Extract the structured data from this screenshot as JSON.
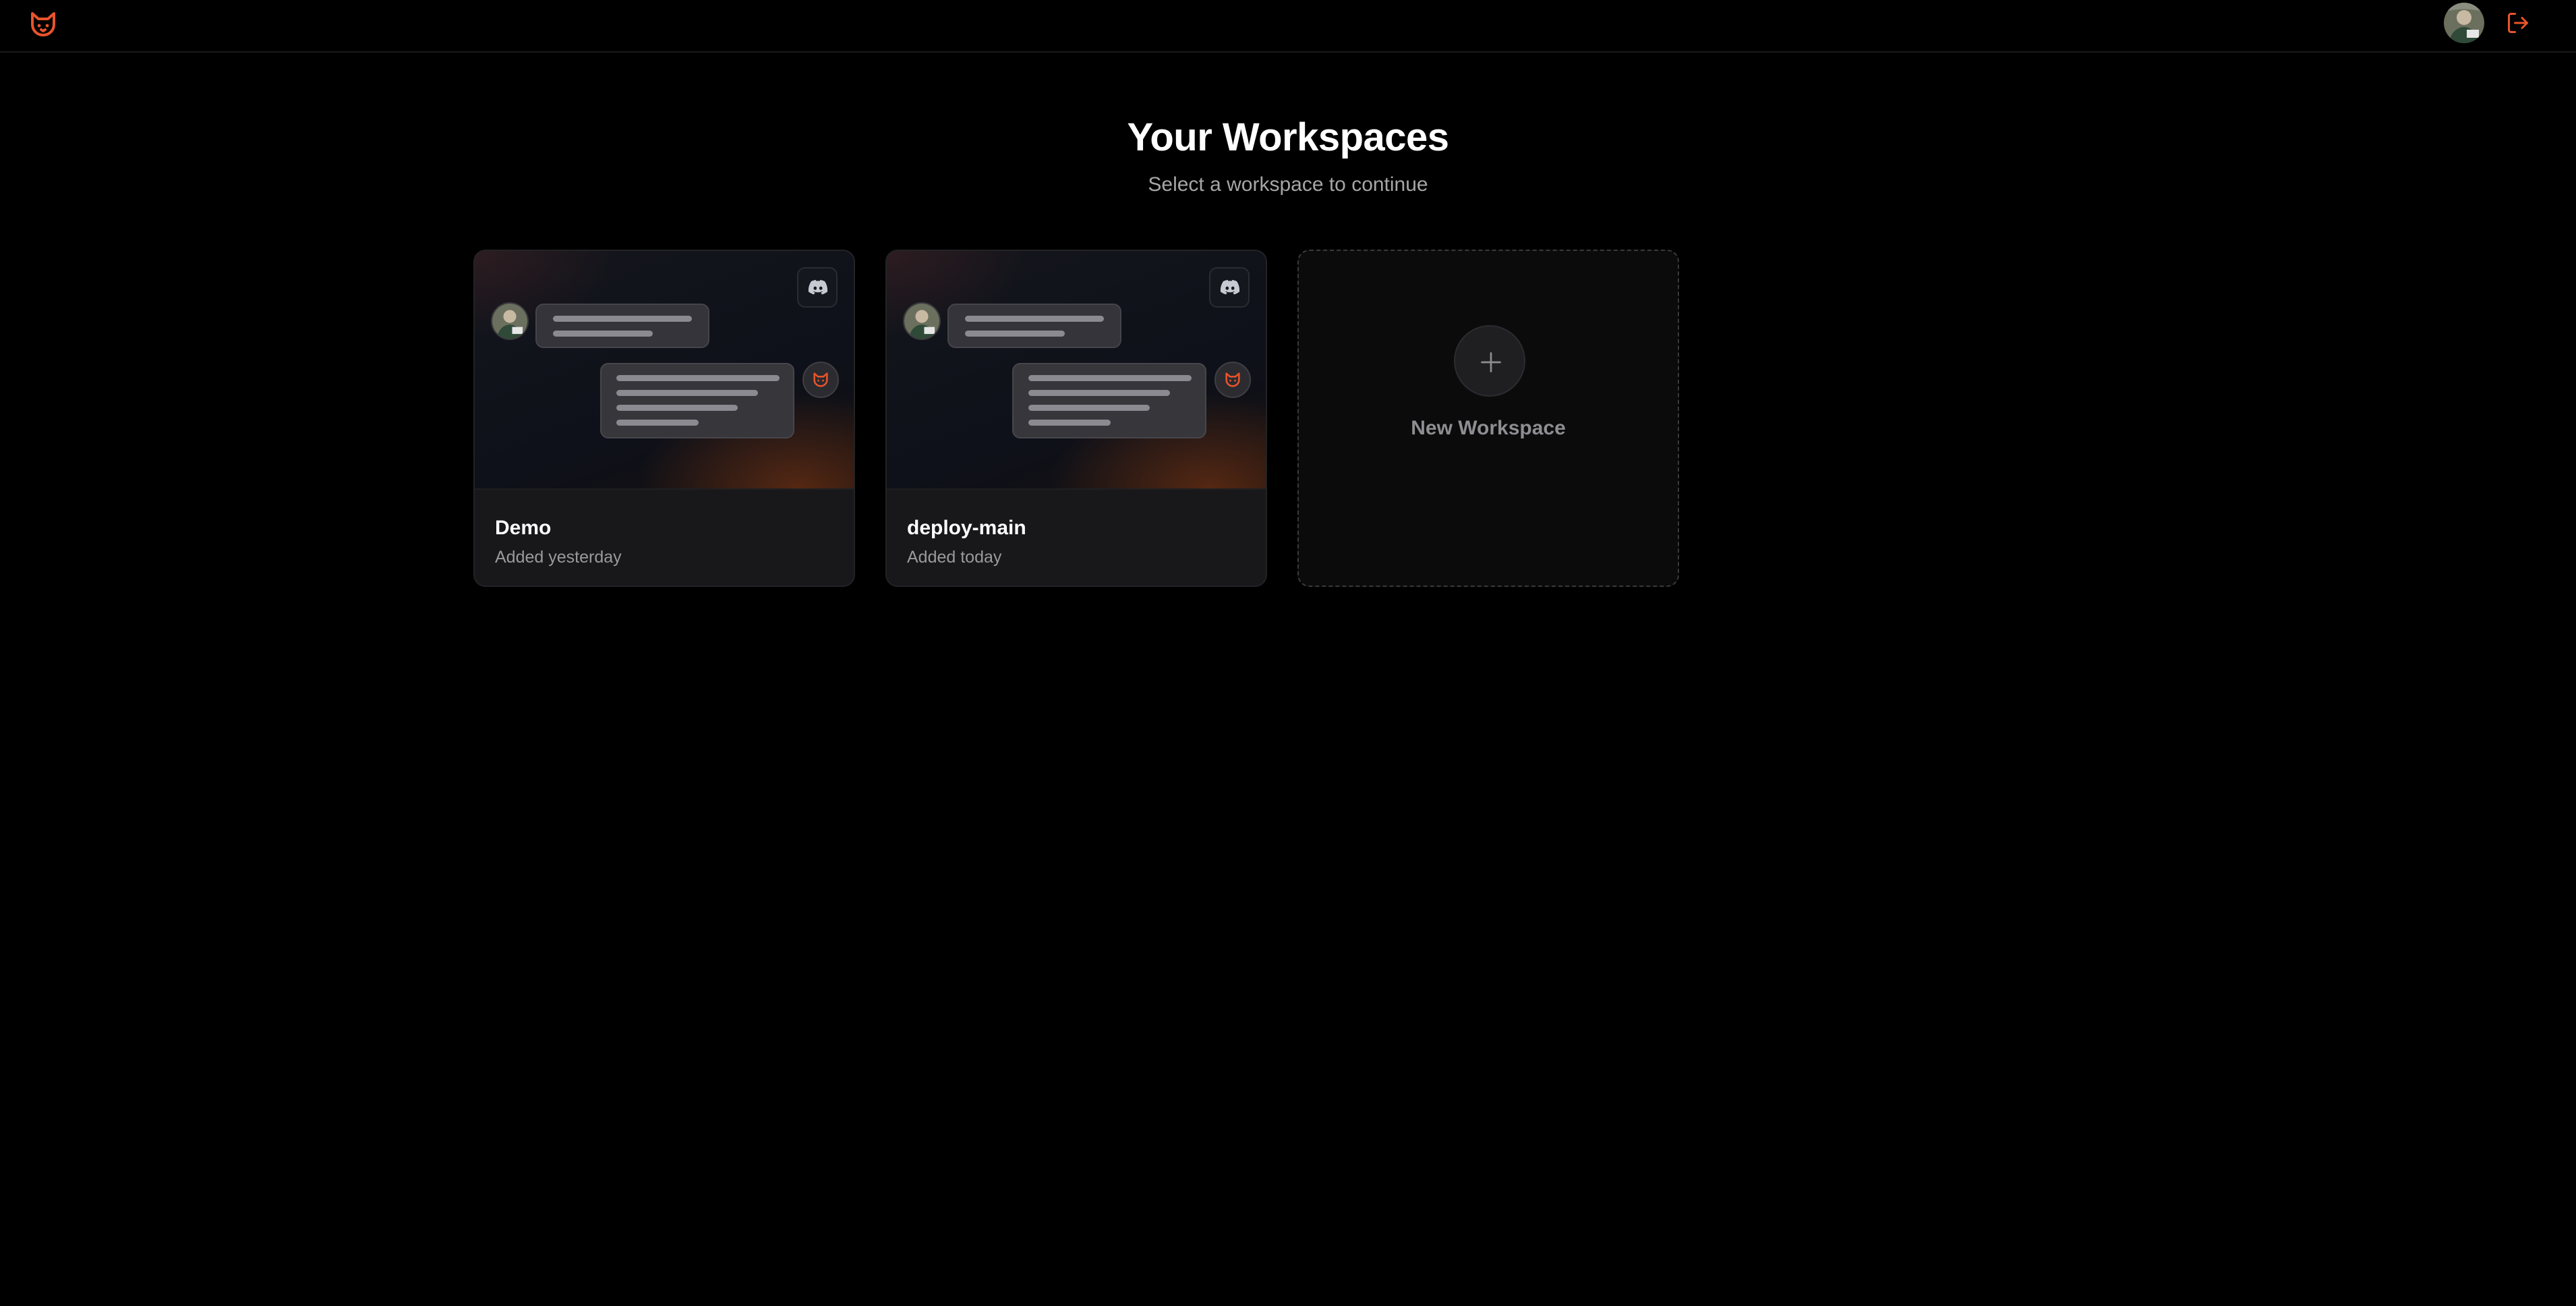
{
  "header": {
    "logo_icon": "cat-logo-icon",
    "avatar_icon": "user-avatar",
    "logout_icon": "logout-icon",
    "accent_color": "#e8542a"
  },
  "page": {
    "title": "Your Workspaces",
    "subtitle": "Select a workspace to continue"
  },
  "workspaces": [
    {
      "name": "Demo",
      "added": "Added yesterday",
      "platform_icon": "discord-icon"
    },
    {
      "name": "deploy-main",
      "added": "Added today",
      "platform_icon": "discord-icon"
    }
  ],
  "new_workspace": {
    "label": "New Workspace",
    "icon": "plus-icon"
  }
}
